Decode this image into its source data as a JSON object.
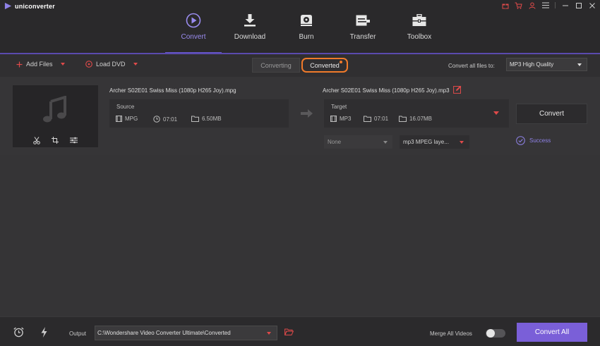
{
  "app": {
    "name": "uniconverter"
  },
  "nav": {
    "tabs": [
      {
        "label": "Convert",
        "icon": "convert-icon",
        "active": true
      },
      {
        "label": "Download",
        "icon": "download-icon"
      },
      {
        "label": "Burn",
        "icon": "burn-icon"
      },
      {
        "label": "Transfer",
        "icon": "transfer-icon"
      },
      {
        "label": "Toolbox",
        "icon": "toolbox-icon"
      }
    ]
  },
  "toolbar": {
    "add_files": "Add Files",
    "load_dvd": "Load DVD",
    "segment": {
      "converting": "Converting",
      "converted": "Converted"
    },
    "convert_all_label": "Convert all files to:",
    "convert_all_value": "MP3 High Quality"
  },
  "item": {
    "source_name": "Archer S02E01 Swiss Miss (1080p H265 Joy).mpg",
    "source": {
      "label": "Source",
      "format": "MPG",
      "duration": "07:01",
      "size": "6.50MB"
    },
    "target_name": "Archer S02E01 Swiss Miss (1080p H265 Joy).mp3",
    "target": {
      "label": "Target",
      "format": "MP3",
      "duration": "07:01",
      "size": "16.07MB"
    },
    "convert_button": "Convert",
    "subtitle_select": "None",
    "audio_select": "mp3 MPEG laye...",
    "status": "Success"
  },
  "bottom": {
    "output_label": "Output",
    "output_path": "C:\\Wondershare Video Converter Ultimate\\Converted",
    "merge_label": "Merge All Videos",
    "merge_on": false,
    "convert_all": "Convert All"
  },
  "colors": {
    "accent": "#7a5fd8",
    "highlight": "#f07a2a",
    "danger": "#e04a4a",
    "success": "#8f82e8"
  }
}
